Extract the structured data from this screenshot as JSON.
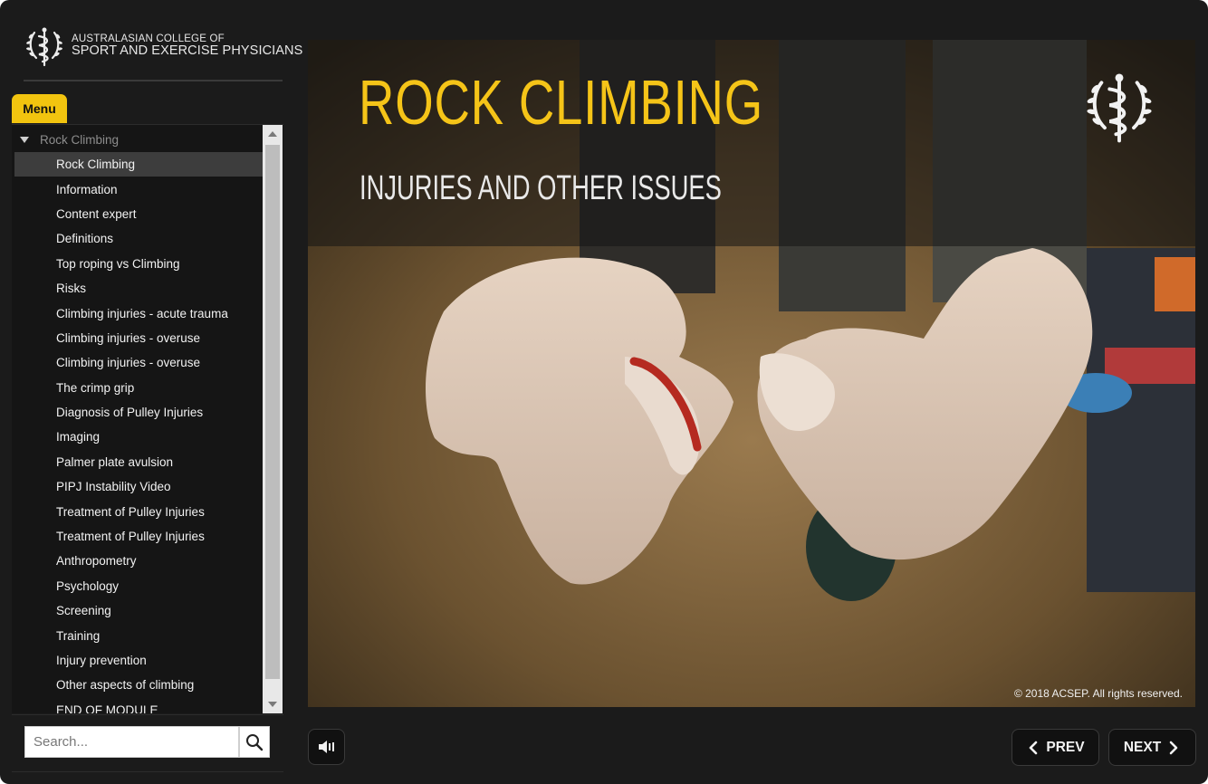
{
  "brand": {
    "line1": "AUSTRALASIAN COLLEGE OF",
    "line2": "SPORT AND EXERCISE PHYSICIANS",
    "logo_icon": "caduceus-laurel-icon"
  },
  "menu": {
    "tab_label": "Menu",
    "group_label": "Rock Climbing",
    "items": [
      {
        "label": "Rock Climbing",
        "active": true
      },
      {
        "label": "Information"
      },
      {
        "label": "Content expert"
      },
      {
        "label": "Definitions"
      },
      {
        "label": "Top roping vs Climbing"
      },
      {
        "label": "Risks"
      },
      {
        "label": "Climbing injuries - acute trauma"
      },
      {
        "label": "Climbing injuries - overuse"
      },
      {
        "label": "Climbing injuries - overuse"
      },
      {
        "label": "The crimp grip"
      },
      {
        "label": "Diagnosis of Pulley Injuries"
      },
      {
        "label": "Imaging"
      },
      {
        "label": "Palmer plate avulsion"
      },
      {
        "label": "PIPJ Instability Video"
      },
      {
        "label": "Treatment of Pulley Injuries"
      },
      {
        "label": "Treatment of Pulley Injuries"
      },
      {
        "label": "Anthropometry"
      },
      {
        "label": "Psychology"
      },
      {
        "label": "Screening"
      },
      {
        "label": "Training"
      },
      {
        "label": "Injury prevention"
      },
      {
        "label": "Other aspects of climbing"
      },
      {
        "label": "END OF MODULE"
      }
    ]
  },
  "search": {
    "placeholder": "Search...",
    "icon": "search-icon"
  },
  "slide": {
    "title": "ROCK CLIMBING",
    "subtitle": "INJURIES AND OTHER ISSUES",
    "copyright": "© 2018 ACSEP. All rights reserved.",
    "emblem_icon": "caduceus-laurel-icon"
  },
  "controls": {
    "audio_icon": "speaker-icon",
    "prev_label": "PREV",
    "next_label": "NEXT"
  },
  "colors": {
    "accent": "#f5c418",
    "frame": "#1b1b1b",
    "panel": "#151515",
    "active_item": "#3d3d3d"
  }
}
